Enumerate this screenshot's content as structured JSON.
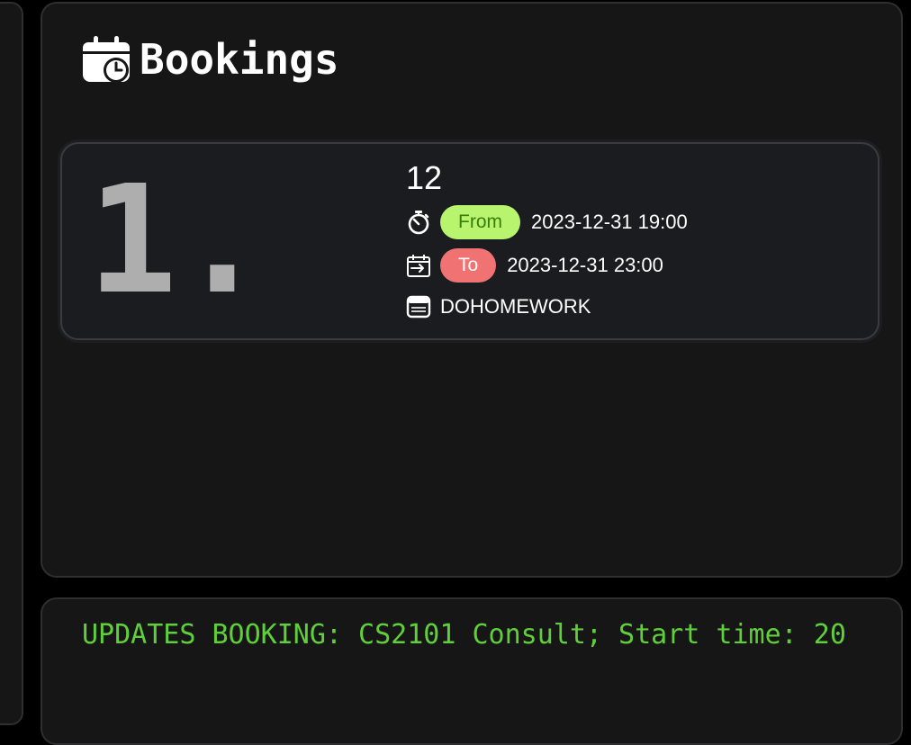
{
  "bookings_panel": {
    "title": "Bookings",
    "icon": "calendar-clock-icon"
  },
  "bookings": [
    {
      "index": "1.",
      "name": "12",
      "from_label": "From",
      "from_value": "2023-12-31 19:00",
      "to_label": "To",
      "to_value": "2023-12-31 23:00",
      "description": "DOHOMEWORK",
      "icons": {
        "from": "stopwatch-icon",
        "to": "calendar-arrow-icon",
        "description": "note-icon"
      }
    }
  ],
  "log": {
    "text": "UPDATES BOOKING: CS2101 Consult; Start time: 20"
  },
  "colors": {
    "from_pill_bg": "#b9f46f",
    "from_pill_text": "#3a7d0a",
    "to_pill_bg": "#f07272",
    "log_text": "#5fcf3a"
  }
}
